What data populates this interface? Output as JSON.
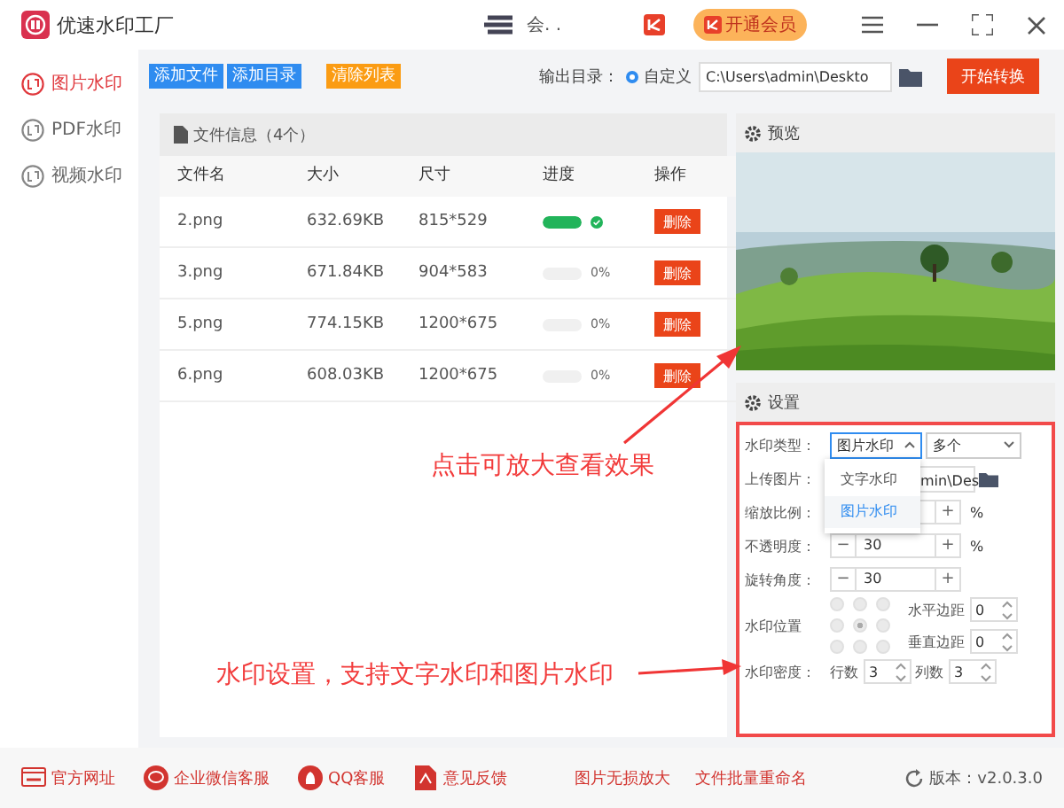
{
  "app": {
    "title": "优速水印工厂",
    "user_name": "会. .",
    "vip_button": "开通会员"
  },
  "sidebar": {
    "items": [
      {
        "label": "图片水印",
        "selected": true
      },
      {
        "label": "PDF水印",
        "selected": false
      },
      {
        "label": "视频水印",
        "selected": false
      }
    ]
  },
  "toolbar": {
    "buttons": [
      {
        "label": "添加文件",
        "kind": "primary"
      },
      {
        "label": "添加目录",
        "kind": "primary"
      },
      {
        "label": "清除列表",
        "kind": "warning"
      }
    ],
    "output_label": "输出目录：",
    "output_option": {
      "label": "自定义",
      "selected": true
    },
    "output_path": "C:\\Users\\admin\\Deskto",
    "start_button": "开始转换"
  },
  "files": {
    "title": "文件信息（4个）",
    "columns": [
      "文件名",
      "大小",
      "尺寸",
      "进度",
      "操作"
    ],
    "rows": [
      {
        "name": "2.png",
        "size": "632.69KB",
        "dimensions": "815*529",
        "level": 1,
        "action": "删除"
      },
      {
        "name": "3.png",
        "size": "671.84KB",
        "dimensions": "904*583",
        "level": 0,
        "reading": "0%",
        "action": "删除"
      },
      {
        "name": "5.png",
        "size": "774.15KB",
        "dimensions": "1200*675",
        "level": 0,
        "reading": "0%",
        "action": "删除"
      },
      {
        "name": "6.png",
        "size": "608.03KB",
        "dimensions": "1200*675",
        "level": 0,
        "reading": "0%",
        "action": "删除"
      }
    ]
  },
  "preview": {
    "title": "预览",
    "kind": "picture"
  },
  "settings": {
    "title": "设置",
    "type": {
      "label": "水印类型：",
      "value": "图片水印",
      "expanded": true,
      "count": "多个",
      "options": [
        {
          "label": "文字水印",
          "selected": false
        },
        {
          "label": "图片水印",
          "selected": true
        }
      ]
    },
    "upload": {
      "label": "上传图片：",
      "value": "min\\Des"
    },
    "scale": {
      "label": "缩放比例：",
      "plus": "+",
      "unit": "%"
    },
    "opacity": {
      "label": "不透明度：",
      "minus": "−",
      "value": "30",
      "plus": "+",
      "unit": "%"
    },
    "rotation": {
      "label": "旋转角度：",
      "minus": "−",
      "value": "30",
      "plus": "+"
    },
    "position": {
      "label": "水印位置",
      "cells": [
        {
          "selected": false
        },
        {
          "selected": false
        },
        {
          "selected": false
        },
        {
          "selected": false
        },
        {
          "selected": true
        },
        {
          "selected": false
        },
        {
          "selected": false
        },
        {
          "selected": false
        },
        {
          "selected": false
        }
      ],
      "h_margin": {
        "label": "水平边距",
        "value": "0"
      },
      "v_margin": {
        "label": "垂直边距",
        "value": "0"
      }
    },
    "density": {
      "label": "水印密度：",
      "rows_label": "行数",
      "rows": "3",
      "cols_label": "列数",
      "cols": "3"
    }
  },
  "annotations": [
    {
      "text": "点击可放大查看效果"
    },
    {
      "text": "水印设置，支持文字水印和图片水印"
    }
  ],
  "footer": {
    "links": [
      {
        "label": "官方网址",
        "kind": "web"
      },
      {
        "label": "企业微信客服",
        "kind": "chat"
      },
      {
        "label": "QQ客服",
        "kind": "qq"
      },
      {
        "label": "意见反馈",
        "kind": "pdf"
      }
    ],
    "tools": [
      "图片无损放大",
      "文件批量重命名"
    ],
    "version": "版本：v2.0.3.0"
  }
}
